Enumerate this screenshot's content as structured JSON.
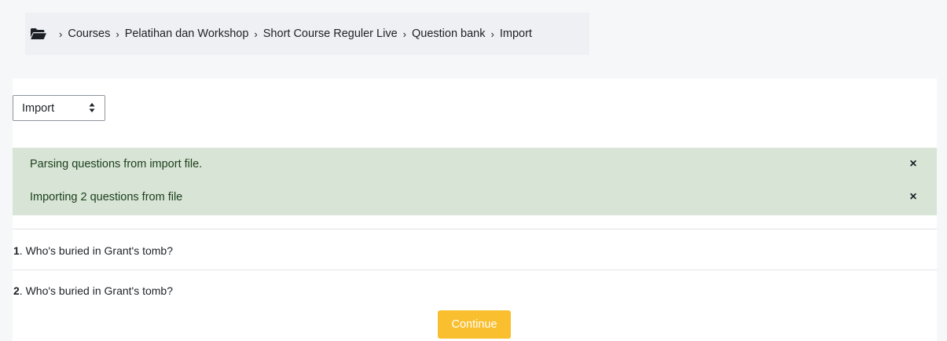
{
  "breadcrumb": {
    "home_icon": "folder-open-icon",
    "separator": "›",
    "items": [
      {
        "label": "Courses"
      },
      {
        "label": "Pelatihan dan Workshop"
      },
      {
        "label": "Short Course Reguler Live"
      },
      {
        "label": "Question bank"
      },
      {
        "label": "Import"
      }
    ]
  },
  "action_select": {
    "value": "Import"
  },
  "alerts": [
    {
      "message": "Parsing questions from import file.",
      "close": "×"
    },
    {
      "message": "Importing 2 questions from file",
      "close": "×"
    }
  ],
  "questions": [
    {
      "number": "1",
      "text": ". Who's buried in Grant's tomb?"
    },
    {
      "number": "2",
      "text": ". Who's buried in Grant's tomb?"
    }
  ],
  "continue_label": "Continue",
  "colors": {
    "alert_bg": "#d7e4d6",
    "continue_bg": "#f9bf2e",
    "page_bg": "#f6f7f9"
  }
}
